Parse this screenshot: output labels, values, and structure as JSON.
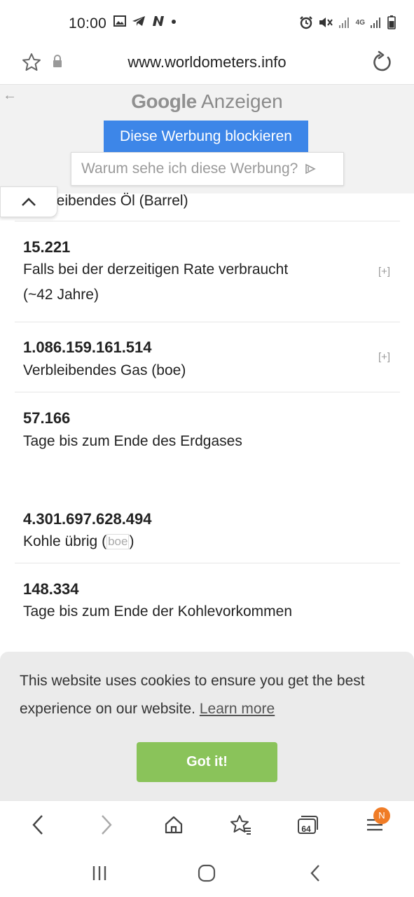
{
  "status_bar": {
    "time": "10:00",
    "left_icons": [
      "image-icon",
      "telegram-icon",
      "n-app-icon",
      "dot-icon"
    ],
    "right_icons": [
      "alarm-icon",
      "mute-icon",
      "signal-icon",
      "signal-4g-icon",
      "battery-icon"
    ],
    "network_label": "4G"
  },
  "browser": {
    "url": "www.worldometers.info"
  },
  "ad": {
    "brand": "Google",
    "label": "Anzeigen",
    "block_button": "Diese Werbung blockieren",
    "why_text": "Warum sehe ich diese Werbung?"
  },
  "content": {
    "partial_label": "leibendes Öl (Barrel)",
    "stats": [
      {
        "value": "15.221",
        "label_line1": "Falls bei der derzeitigen Rate verbraucht",
        "label_line2": "(~42 Jahre)",
        "toggle": "[+]"
      },
      {
        "value": "1.086.159.161.514",
        "label": "Verbleibendes Gas (boe)",
        "toggle": "[+]"
      },
      {
        "value": "57.166",
        "label": "Tage bis zum Ende des Erdgases"
      },
      {
        "value": "4.301.697.628.494",
        "label_prefix": "Kohle übrig (",
        "label_chip": "boe",
        "label_suffix": ")"
      },
      {
        "value": "148.334",
        "label": "Tage bis zum Ende der Kohlevorkommen"
      }
    ]
  },
  "cookie_banner": {
    "text": "This website uses cookies to ensure you get the best experience on our website.",
    "link": "Learn more",
    "button": "Got it!"
  },
  "toolbar": {
    "tab_count": "64",
    "menu_badge": "N"
  },
  "colors": {
    "ad_button": "#3d86e8",
    "cookie_button": "#8ac35a",
    "badge": "#f07c26"
  }
}
